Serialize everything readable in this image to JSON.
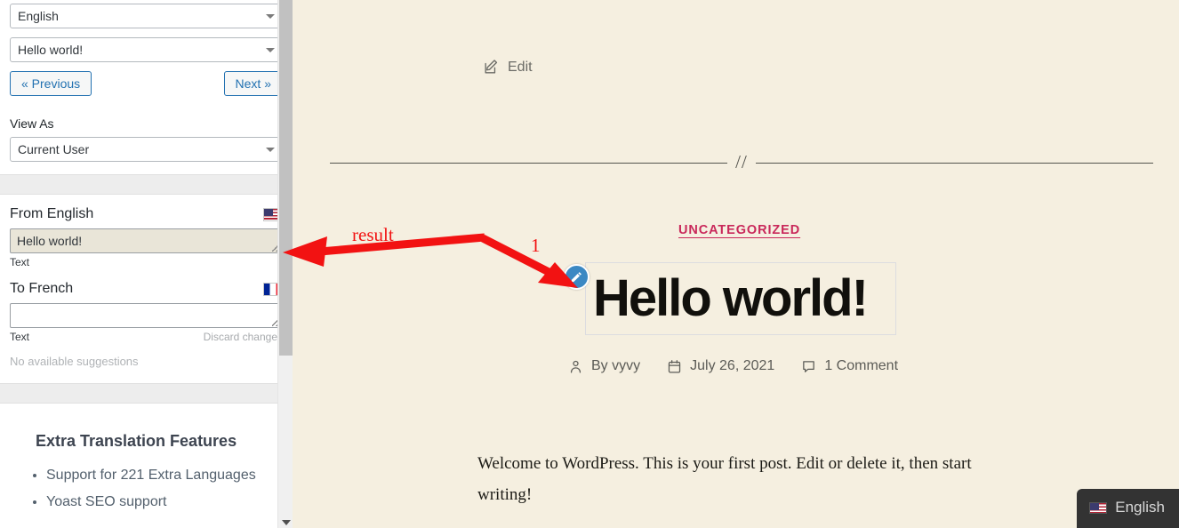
{
  "sidebar": {
    "language_select": {
      "value": "English",
      "icon": "chevron-down-icon"
    },
    "string_select": {
      "value": "Hello world!",
      "icon": "chevron-down-icon"
    },
    "prev_button": "« Previous",
    "next_button": "Next »",
    "view_as_label": "View As",
    "view_as_select": {
      "value": "Current User",
      "icon": "chevron-down-icon"
    },
    "source": {
      "heading": "From English",
      "flag": "us-flag-icon",
      "textarea_value": "Hello world!",
      "sub_label": "Text"
    },
    "target": {
      "heading": "To French",
      "flag": "fr-flag-icon",
      "textarea_value": "",
      "textarea_placeholder": "",
      "sub_label": "Text",
      "discard_action": "Discard changes",
      "suggestions_status": "No available suggestions"
    },
    "extra": {
      "title": "Extra Translation Features",
      "items": [
        "Support for 221 Extra Languages",
        "Yoast SEO support"
      ]
    }
  },
  "main": {
    "edit_link": {
      "label": "Edit",
      "icon": "edit-pencil-icon"
    },
    "divider_glyph": "//",
    "category": "UNCATEGORIZED",
    "post_title": "Hello world!",
    "edit_badge_icon": "pencil-icon",
    "meta": {
      "author": "By vyvy",
      "author_icon": "user-icon",
      "date": "July 26, 2021",
      "date_icon": "calendar-icon",
      "comments": "1 Comment",
      "comments_icon": "comment-icon"
    },
    "body": "Welcome to WordPress. This is your first post. Edit or delete it, then start writing!",
    "language_switcher": {
      "label": "English",
      "flag": "us-flag-icon"
    }
  },
  "annotations": {
    "result_label": "result",
    "step_label": "1"
  },
  "colors": {
    "page_bg": "#f5efe0",
    "accent_blue": "#2271b1",
    "category_pink": "#c9285a",
    "annotation_red": "#f21212",
    "badge_blue": "#3b88c3",
    "switcher_bg": "#333333"
  }
}
